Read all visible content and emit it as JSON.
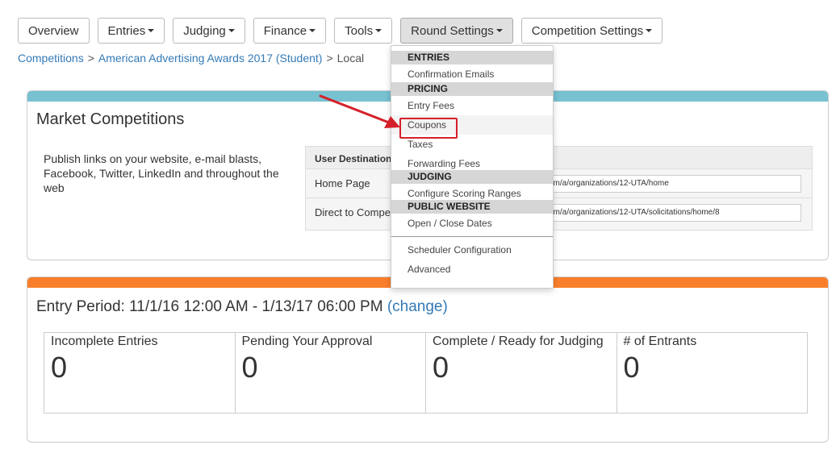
{
  "nav": {
    "overview": "Overview",
    "entries": "Entries",
    "judging": "Judging",
    "finance": "Finance",
    "tools": "Tools",
    "round_settings": "Round Settings",
    "competition_settings": "Competition Settings"
  },
  "breadcrumb": {
    "item1": "Competitions",
    "item2": "American Advertising Awards 2017 (Student)",
    "item3": "Local",
    "separator": ">"
  },
  "market_panel": {
    "title": "Market Competitions",
    "description": "Publish links on your website, e-mail blasts, Facebook, Twitter, LinkedIn and throughout the web",
    "table_header": "User Destination",
    "rows": [
      {
        "label": "Home Page",
        "url": "om/a/organizations/12-UTA/home"
      },
      {
        "label": "Direct to Compe",
        "url": "om/a/organizations/12-UTA/solicitations/home/8"
      }
    ]
  },
  "entry_panel": {
    "period_text": "Entry Period: 11/1/16 12:00 AM - 1/13/17 06:00 PM",
    "change_link": "(change)",
    "stats": [
      {
        "label": "Incomplete Entries",
        "value": "0"
      },
      {
        "label": "Pending Your Approval",
        "value": "0"
      },
      {
        "label": "Complete / Ready for Judging",
        "value": "0"
      },
      {
        "label": "# of Entrants",
        "value": "0"
      }
    ]
  },
  "dropdown": {
    "entries_header": "ENTRIES",
    "confirmation_emails": "Confirmation Emails",
    "pricing_header": "PRICING",
    "entry_fees": "Entry Fees",
    "coupons": "Coupons",
    "taxes": "Taxes",
    "forwarding_fees": "Forwarding Fees",
    "judging_header": "JUDGING",
    "configure_scoring_ranges": "Configure Scoring Ranges",
    "public_website_header": "PUBLIC WEBSITE",
    "open_close_dates": "Open / Close Dates",
    "scheduler_configuration": "Scheduler Configuration",
    "advanced": "Advanced"
  },
  "colors": {
    "link": "#337ab7",
    "blue_bar": "#77c1d1",
    "orange_bar": "#fa7f2c",
    "highlight": "#d5202a"
  },
  "icons": {
    "caret": "chevron-down-icon",
    "annotation": "red-arrow-icon"
  }
}
